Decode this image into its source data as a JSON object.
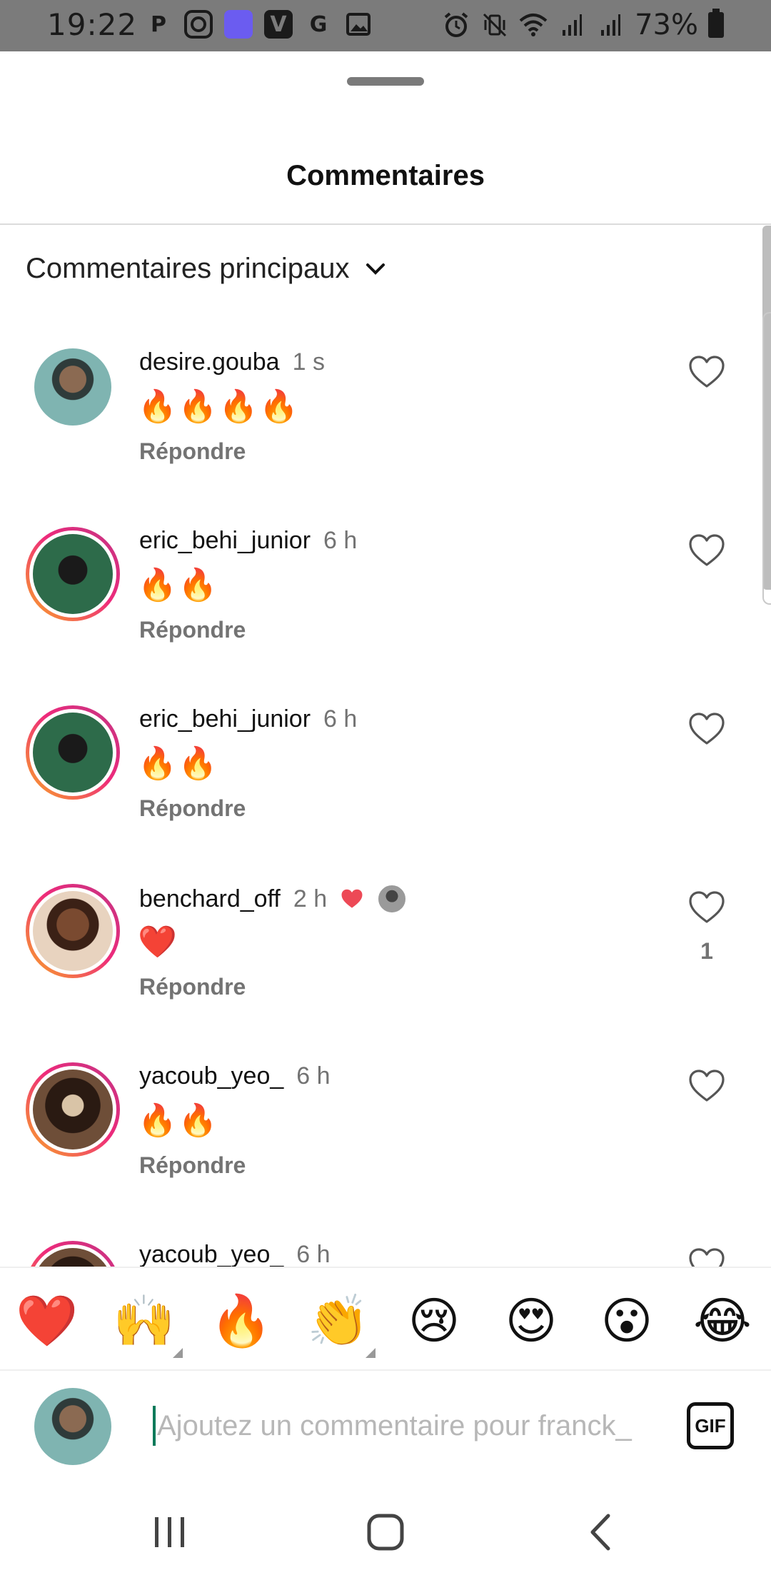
{
  "status_bar": {
    "time": "19:22",
    "apps": [
      "P",
      "instagram-icon",
      "todo-icon",
      "V",
      "G",
      "gallery-icon"
    ],
    "battery": "73%"
  },
  "sheet": {
    "title": "Commentaires",
    "filter_label": "Commentaires principaux"
  },
  "comments": [
    {
      "username": "desire.gouba",
      "time": "1 s",
      "text": "🔥🔥🔥🔥",
      "reply": "Répondre",
      "like_count": "",
      "story_ring": false,
      "liked_by_author": false
    },
    {
      "username": "eric_behi_junior",
      "time": "6 h",
      "text": "🔥🔥",
      "reply": "Répondre",
      "like_count": "",
      "story_ring": true,
      "liked_by_author": false
    },
    {
      "username": "eric_behi_junior",
      "time": "6 h",
      "text": "🔥🔥",
      "reply": "Répondre",
      "like_count": "",
      "story_ring": true,
      "liked_by_author": false
    },
    {
      "username": "benchard_off",
      "time": "2 h",
      "text": "❤️",
      "reply": "Répondre",
      "like_count": "1",
      "story_ring": true,
      "liked_by_author": true
    },
    {
      "username": "yacoub_yeo_",
      "time": "6 h",
      "text": "🔥🔥",
      "reply": "Répondre",
      "like_count": "",
      "story_ring": true,
      "liked_by_author": false
    },
    {
      "username": "yacoub_yeo_",
      "time": "6 h",
      "text": "",
      "reply": "",
      "like_count": "",
      "story_ring": true,
      "liked_by_author": false
    }
  ],
  "emoji_bar": [
    "❤️",
    "🙌",
    "🔥",
    "👏",
    "😢",
    "😍",
    "😮",
    "😂"
  ],
  "composer": {
    "placeholder": "Ajoutez un commentaire pour franck_",
    "value": "",
    "gif_label": "GIF"
  },
  "colors": {
    "heart_red": "#ed4956",
    "story_ring_start": "#f9a825",
    "story_ring_end": "#c13584",
    "secondary_text": "#737373"
  }
}
